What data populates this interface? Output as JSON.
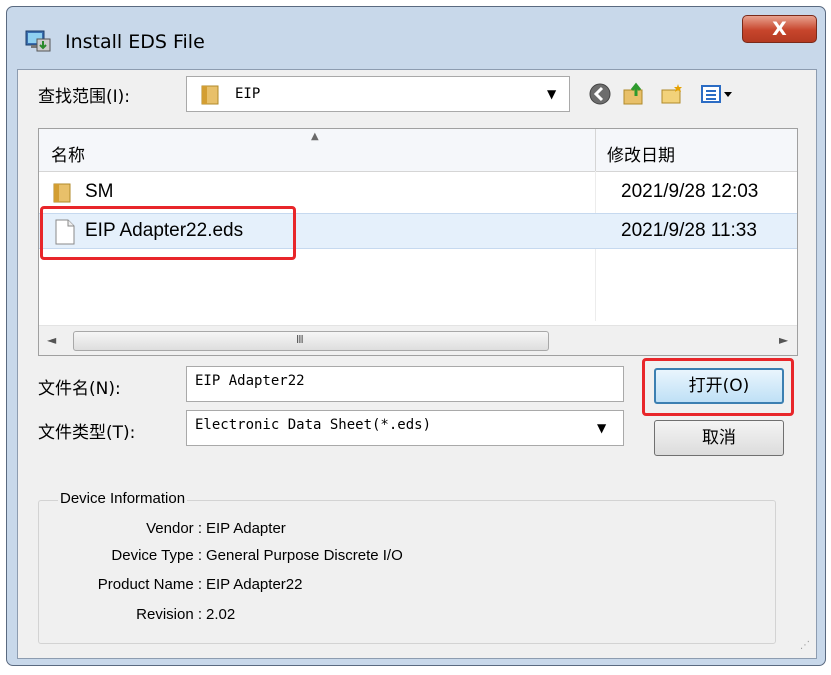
{
  "window": {
    "title": "Install EDS File",
    "close_label": "X"
  },
  "look_in": {
    "label": "查找范围(I):",
    "value": "EIP"
  },
  "file_list": {
    "columns": [
      "名称",
      "修改日期"
    ],
    "rows": [
      {
        "name": "SM",
        "date": "2021/9/28 12:03",
        "icon": "folder-icon"
      },
      {
        "name": "EIP Adapter22.eds",
        "date": "2021/9/28 11:33",
        "icon": "file-icon"
      }
    ],
    "scroll_grip": "III"
  },
  "filename": {
    "label": "文件名(N):",
    "value": "EIP Adapter22"
  },
  "filetype": {
    "label": "文件类型(T):",
    "value": "Electronic Data Sheet(*.eds)"
  },
  "buttons": {
    "open": "打开(O)",
    "cancel": "取消"
  },
  "device_info": {
    "title": "Device Information",
    "fields": [
      {
        "key": "Vendor :",
        "value": "EIP Adapter"
      },
      {
        "key": "Device Type :",
        "value": "General Purpose Discrete I/O"
      },
      {
        "key": "Product Name :",
        "value": "EIP Adapter22"
      },
      {
        "key": "Revision :",
        "value": "2.02"
      }
    ]
  },
  "colors": {
    "highlight_border": "#e8262a",
    "selection": "#e5f0fb",
    "close_button": "#c7452c"
  }
}
